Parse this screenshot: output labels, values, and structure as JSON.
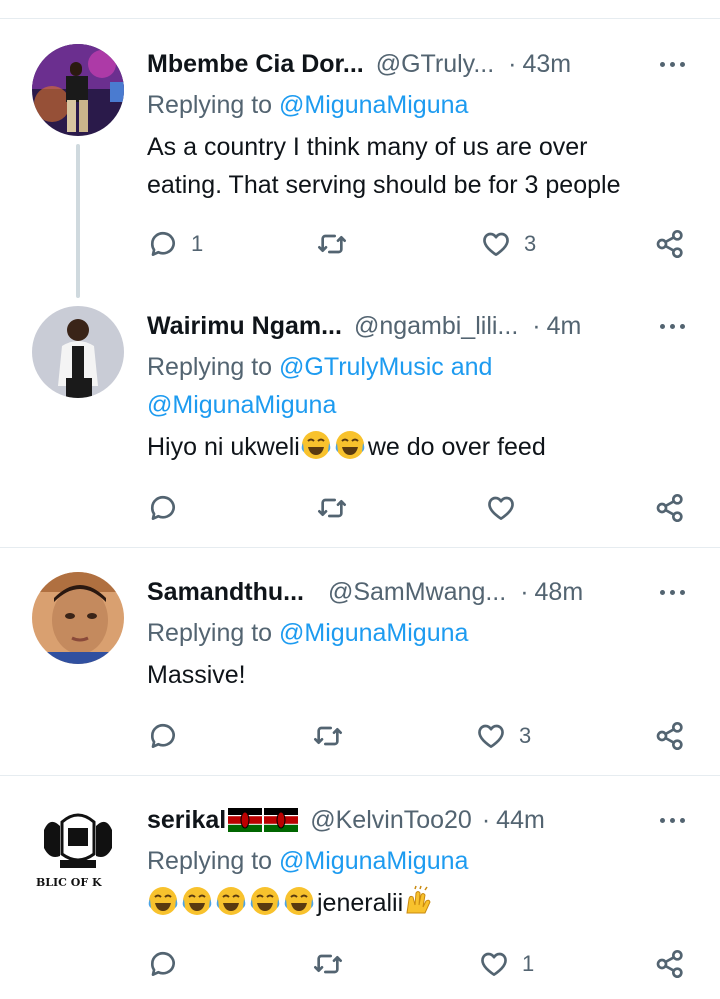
{
  "tweets": [
    {
      "name": "Mbembe Cia Dor...",
      "handle": "@GTruly...",
      "time": "43m",
      "replying_prefix": "Replying to ",
      "replying_links": "@MigunaMiguna",
      "replying_line2": "",
      "text_line1": "As a country I think many of us are  over",
      "text_line2": "eating. That serving should be for 3 people",
      "reply_count": "1",
      "retweet_count": "",
      "like_count": "3"
    },
    {
      "name": "Wairimu Ngam...",
      "handle": "@ngambi_lili...",
      "time": "4m",
      "replying_prefix": "Replying to ",
      "replying_links": "@GTrulyMusic and",
      "replying_line2": "@MigunaMiguna",
      "text_before": "Hiyo ni ukweli",
      "text_after": "we do over feed",
      "reply_count": "",
      "retweet_count": "",
      "like_count": ""
    },
    {
      "name": "Samandthu...",
      "handle": "@SamMwang...",
      "time": "48m",
      "replying_prefix": "Replying to ",
      "replying_links": "@MigunaMiguna",
      "text_line1": "Massive!",
      "reply_count": "",
      "retweet_count": "",
      "like_count": "3"
    },
    {
      "name": "serikal",
      "handle": "@KelvinToo20",
      "time": "44m",
      "replying_prefix": "Replying to ",
      "replying_links": "@MigunaMiguna",
      "text_after": "jeneralii",
      "reply_count": "",
      "retweet_count": "",
      "like_count": "1",
      "avatar_text": "BLIC OF K"
    }
  ],
  "separator": "·",
  "icons": [
    "reply-icon",
    "retweet-icon",
    "like-icon",
    "share-icon",
    "more-icon"
  ],
  "colors": {
    "link": "#1d9bf0",
    "secondary": "#536471",
    "text": "#0f1419",
    "divider": "#e6ecf0"
  }
}
